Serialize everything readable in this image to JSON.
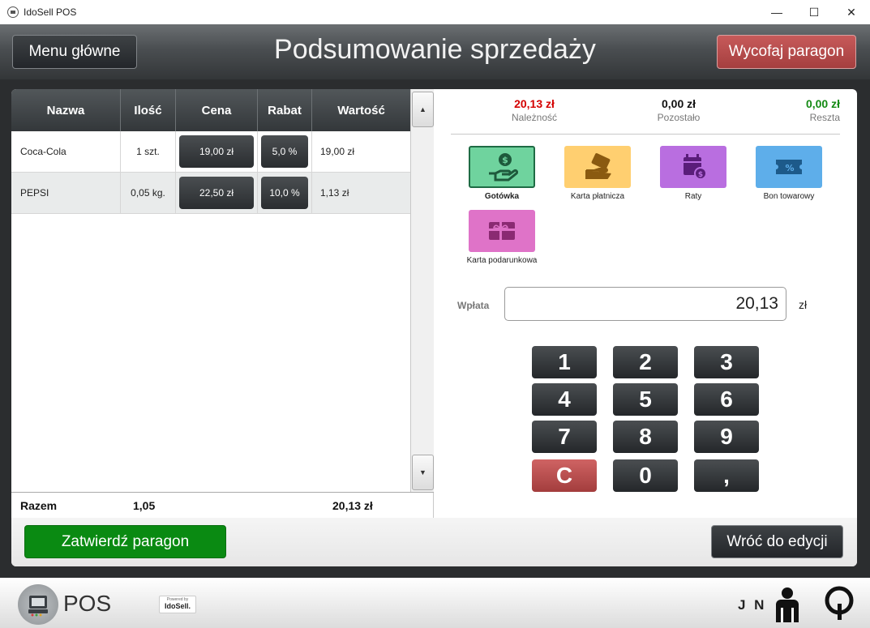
{
  "window": {
    "title": "IdoSell POS",
    "icon": "app-icon",
    "minimize": "—",
    "maximize": "☐",
    "close": "✕"
  },
  "header": {
    "menu_button": "Menu główne",
    "title": "Podsumowanie sprzedaży",
    "cancel_button": "Wycofaj paragon"
  },
  "table": {
    "columns": [
      "Nazwa",
      "Ilość",
      "Cena",
      "Rabat",
      "Wartość"
    ],
    "rows": [
      {
        "name": "Coca-Cola",
        "qty": "1 szt.",
        "price": "19,00 zł",
        "discount": "5,0 %",
        "value": "19,00 zł"
      },
      {
        "name": "PEPSI",
        "qty": "0,05 kg.",
        "price": "22,50 zł",
        "discount": "10,0 %",
        "value": "1,13 zł"
      }
    ],
    "totals": {
      "label": "Razem",
      "qty": "1,05",
      "value": "20,13 zł"
    }
  },
  "summary": {
    "due": {
      "amount": "20,13 zł",
      "label": "Należność",
      "color": "#d40000"
    },
    "remaining": {
      "amount": "0,00 zł",
      "label": "Pozostało",
      "color": "#111111"
    },
    "change": {
      "amount": "0,00 zł",
      "label": "Reszta",
      "color": "#138a13"
    }
  },
  "payment_methods": [
    {
      "label": "Gotówka",
      "icon": "cash-hand-icon",
      "color": "#6fd39e",
      "selected": true
    },
    {
      "label": "Karta płatnicza",
      "icon": "card-hand-icon",
      "color": "#ffcf70",
      "selected": false
    },
    {
      "label": "Raty",
      "icon": "calendar-money-icon",
      "color": "#b96ee0",
      "selected": false
    },
    {
      "label": "Bon towarowy",
      "icon": "voucher-percent-icon",
      "color": "#5eaeea",
      "selected": false
    },
    {
      "label": "Karta podarunkowa",
      "icon": "gift-card-icon",
      "color": "#df73c8",
      "selected": false
    }
  ],
  "payment": {
    "label": "Wpłata",
    "value": "20,13",
    "currency": "zł"
  },
  "keypad": {
    "keys": [
      "1",
      "2",
      "3",
      "4",
      "5",
      "6",
      "7",
      "8",
      "9",
      "C",
      "0",
      ","
    ]
  },
  "actions": {
    "confirm": "Zatwierdź paragon",
    "back": "Wróć do edycji"
  },
  "footer": {
    "pos_label": "POS",
    "powered_by": "Powered by",
    "brand": "IdoSell.",
    "user_initials": "J N"
  },
  "colors": {
    "accent_green": "#0a8a12",
    "cancel_red": "#b04848"
  }
}
